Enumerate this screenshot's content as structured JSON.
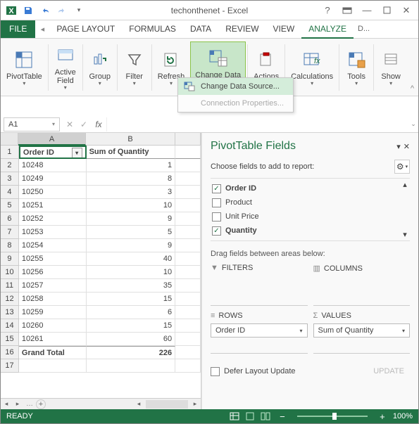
{
  "title": "techonthenet - Excel",
  "tabs": {
    "file": "FILE",
    "page_layout": "PAGE LAYOUT",
    "formulas": "FORMULAS",
    "data": "DATA",
    "review": "REVIEW",
    "view": "VIEW",
    "analyze": "ANALYZE",
    "more": "D..."
  },
  "ribbon": {
    "pivottable": "PivotTable",
    "active_field": "Active\nField",
    "group": "Group",
    "filter": "Filter",
    "refresh": "Refresh",
    "change_data": "Change Data\nSource",
    "actions": "Actions",
    "calculations": "Calculations",
    "tools": "Tools",
    "show": "Show"
  },
  "dropdown": {
    "change": "Change Data Source...",
    "conn": "Connection Properties..."
  },
  "namebox": "A1",
  "columns": [
    "A",
    "B"
  ],
  "headers": {
    "a": "Order ID",
    "b": "Sum of Quantity"
  },
  "rows": [
    {
      "n": 2,
      "a": "10248",
      "b": "1"
    },
    {
      "n": 3,
      "a": "10249",
      "b": "8"
    },
    {
      "n": 4,
      "a": "10250",
      "b": "3"
    },
    {
      "n": 5,
      "a": "10251",
      "b": "10"
    },
    {
      "n": 6,
      "a": "10252",
      "b": "9"
    },
    {
      "n": 7,
      "a": "10253",
      "b": "5"
    },
    {
      "n": 8,
      "a": "10254",
      "b": "9"
    },
    {
      "n": 9,
      "a": "10255",
      "b": "40"
    },
    {
      "n": 10,
      "a": "10256",
      "b": "10"
    },
    {
      "n": 11,
      "a": "10257",
      "b": "35"
    },
    {
      "n": 12,
      "a": "10258",
      "b": "15"
    },
    {
      "n": 13,
      "a": "10259",
      "b": "6"
    },
    {
      "n": 14,
      "a": "10260",
      "b": "15"
    },
    {
      "n": 15,
      "a": "10261",
      "b": "60"
    }
  ],
  "grand_total": {
    "label": "Grand Total",
    "value": "226"
  },
  "fields_panel": {
    "title": "PivotTable Fields",
    "choose": "Choose fields to add to report:",
    "fields": [
      {
        "name": "Order ID",
        "checked": true
      },
      {
        "name": "Product",
        "checked": false
      },
      {
        "name": "Unit Price",
        "checked": false
      },
      {
        "name": "Quantity",
        "checked": true
      }
    ],
    "drag": "Drag fields between areas below:",
    "filters": "FILTERS",
    "columns": "COLUMNS",
    "rows_l": "ROWS",
    "values": "VALUES",
    "row_pill": "Order ID",
    "value_pill": "Sum of Quantity",
    "defer": "Defer Layout Update",
    "update": "UPDATE"
  },
  "status": {
    "ready": "READY",
    "zoom": "100%"
  }
}
